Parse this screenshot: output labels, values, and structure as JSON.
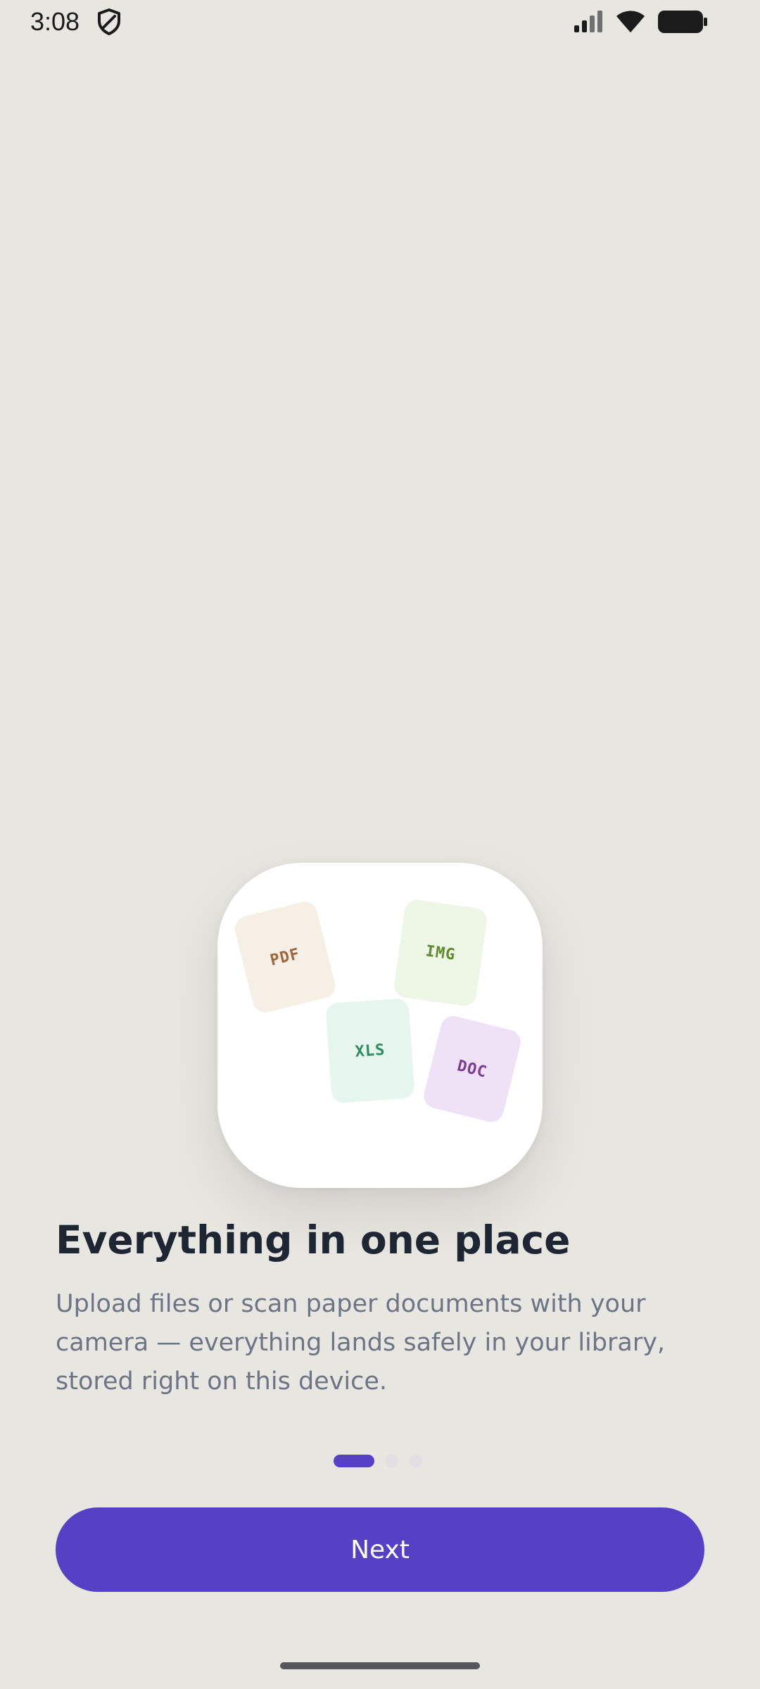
{
  "status_bar": {
    "time": "3:08",
    "icons": [
      "shield-icon",
      "signal-icon",
      "wifi-icon",
      "battery-icon"
    ]
  },
  "illustration": {
    "tiles": [
      {
        "label": "PDF",
        "color": "#a06538",
        "bg": "#f6efe6"
      },
      {
        "label": "IMG",
        "color": "#5f8a30",
        "bg": "#eef6e6"
      },
      {
        "label": "XLS",
        "color": "#2f8a5e",
        "bg": "#e4f6ee"
      },
      {
        "label": "DOC",
        "color": "#7d3b98",
        "bg": "#f0e2f6"
      }
    ]
  },
  "onboarding": {
    "title": "Everything in one place",
    "body": "Upload files or scan paper documents with your camera — everything lands safely in your library, stored right on this device.",
    "page_count": 3,
    "current_page": 1,
    "next_label": "Next"
  },
  "colors": {
    "accent": "#5641c6",
    "background": "#e8e6e1",
    "title": "#1e2533",
    "body": "#6c7485"
  }
}
